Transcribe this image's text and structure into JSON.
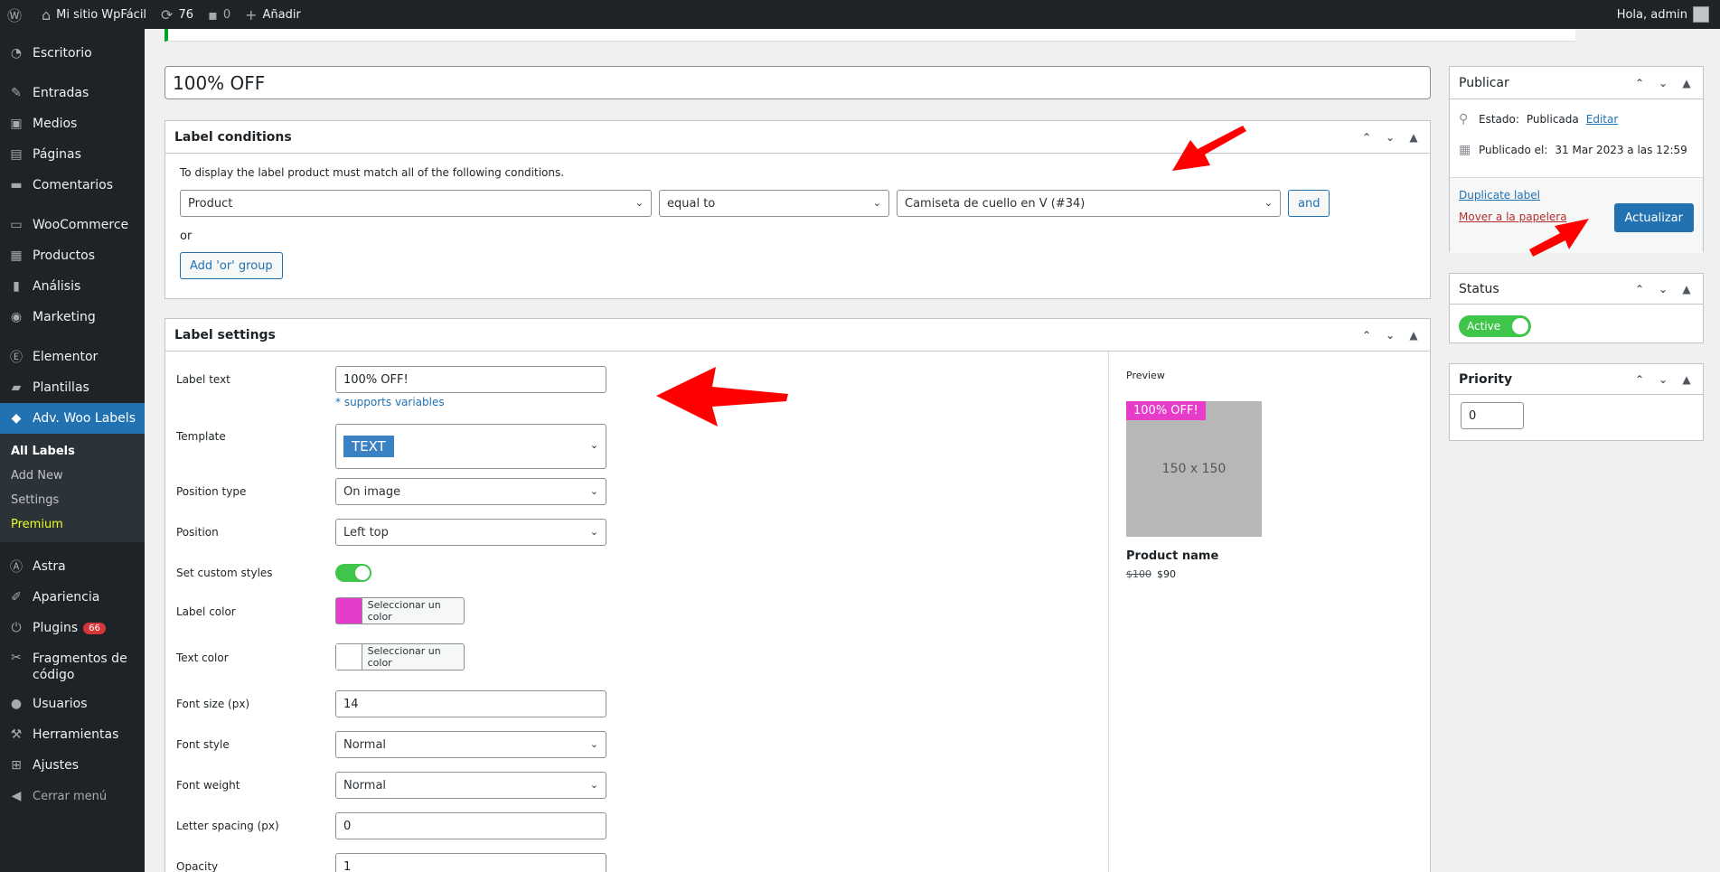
{
  "adminbar": {
    "site_name": "Mi sitio WpFácil",
    "updates_count": "76",
    "comments_count": "0",
    "add_label": "Añadir",
    "greeting": "Hola, admin"
  },
  "sidebar": {
    "items": [
      {
        "label": "Escritorio",
        "icon": "dashboard-icon"
      },
      {
        "label": "Entradas",
        "icon": "pin-icon"
      },
      {
        "label": "Medios",
        "icon": "media-icon"
      },
      {
        "label": "Páginas",
        "icon": "pages-icon"
      },
      {
        "label": "Comentarios",
        "icon": "comments-icon"
      },
      {
        "label": "WooCommerce",
        "icon": "woo-icon"
      },
      {
        "label": "Productos",
        "icon": "products-icon"
      },
      {
        "label": "Análisis",
        "icon": "chart-icon"
      },
      {
        "label": "Marketing",
        "icon": "megaphone-icon"
      },
      {
        "label": "Elementor",
        "icon": "elementor-icon"
      },
      {
        "label": "Plantillas",
        "icon": "folder-icon"
      },
      {
        "label": "Adv. Woo Labels",
        "icon": "tag-icon"
      },
      {
        "label": "Astra",
        "icon": "astra-icon"
      },
      {
        "label": "Apariencia",
        "icon": "brush-icon"
      },
      {
        "label": "Plugins",
        "icon": "plug-icon",
        "badge": "66"
      },
      {
        "label": "Fragmentos de código",
        "icon": "scissors-icon"
      },
      {
        "label": "Usuarios",
        "icon": "user-icon"
      },
      {
        "label": "Herramientas",
        "icon": "wrench-icon"
      },
      {
        "label": "Ajustes",
        "icon": "settings-icon"
      }
    ],
    "submenu": [
      "All Labels",
      "Add New",
      "Settings",
      "Premium"
    ],
    "collapse_label": "Cerrar menú"
  },
  "post": {
    "title": "100% OFF"
  },
  "conditions": {
    "title": "Label conditions",
    "intro": "To display the label product must match all of the following conditions.",
    "field": "Product",
    "operator": "equal to",
    "value": "Camiseta de cuello en V (#34)",
    "and_label": "and",
    "or_label": "or",
    "add_or_label": "Add 'or' group"
  },
  "settings": {
    "title": "Label settings",
    "label_text_label": "Label text",
    "label_text_value": "100% OFF!",
    "supports_note": "* supports variables",
    "template_label": "Template",
    "template_value": "TEXT",
    "position_type_label": "Position type",
    "position_type_value": "On image",
    "position_label": "Position",
    "position_value": "Left top",
    "custom_styles_label": "Set custom styles",
    "label_color_label": "Label color",
    "label_color_value": "#e53cc9",
    "color_button": "Seleccionar un color",
    "text_color_label": "Text color",
    "text_color_value": "#ffffff",
    "font_size_label": "Font size (px)",
    "font_size_value": "14",
    "font_style_label": "Font style",
    "font_style_value": "Normal",
    "font_weight_label": "Font weight",
    "font_weight_value": "Normal",
    "letter_spacing_label": "Letter spacing (px)",
    "letter_spacing_value": "0",
    "opacity_label": "Opacity",
    "opacity_value": "1"
  },
  "preview": {
    "heading": "Preview",
    "badge": "100% OFF!",
    "image_text": "150 x 150",
    "product_name": "Product name",
    "old_price": "$100",
    "new_price": "$90"
  },
  "publish": {
    "title": "Publicar",
    "status_prefix": "Estado:",
    "status_value": "Publicada",
    "edit_link": "Editar",
    "published_prefix": "Publicado el:",
    "published_value": "31 Mar 2023 a las 12:59",
    "duplicate_link": "Duplicate label",
    "trash_link": "Mover a la papelera",
    "update_button": "Actualizar"
  },
  "status": {
    "title": "Status",
    "toggle_label": "Active"
  },
  "priority": {
    "title": "Priority",
    "value": "0"
  },
  "colors": {
    "accent": "#2271b1",
    "sidebar_bg": "#1d2327",
    "annotation_red": "#ff0000",
    "toggle_green": "#3ec54a"
  }
}
